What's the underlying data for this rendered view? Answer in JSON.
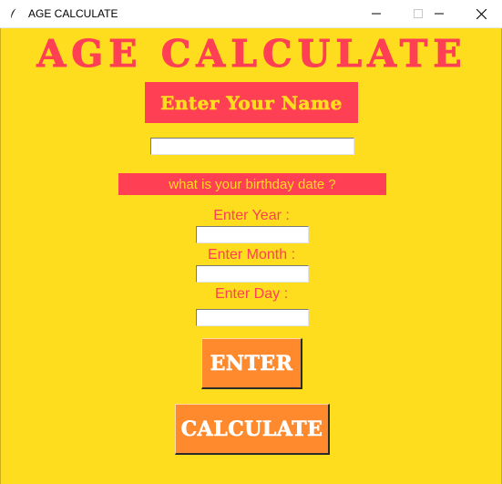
{
  "window": {
    "title": "AGE CALCULATE",
    "minimize_icon": "minimize-icon",
    "maximize_icon": "maximize-icon",
    "close_icon": "close-icon",
    "app_icon": "feather-icon"
  },
  "app": {
    "heading": "Age Calculate",
    "name_label": "Enter Your Name",
    "name_value": "",
    "birthday_label": "what is your birthday date ?",
    "year_label": "Enter Year :",
    "year_value": "",
    "month_label": "Enter Month :",
    "month_value": "",
    "day_label": "Enter Day :",
    "day_value": "",
    "enter_button": "ENTER",
    "calculate_button": "CALCULATE"
  },
  "colors": {
    "background": "#FEDD1F",
    "accent_red": "#FF3F53",
    "label_text_yellow": "#FEDD1F",
    "button_orange": "#FF8A2E",
    "button_text": "#FFFFFF"
  }
}
